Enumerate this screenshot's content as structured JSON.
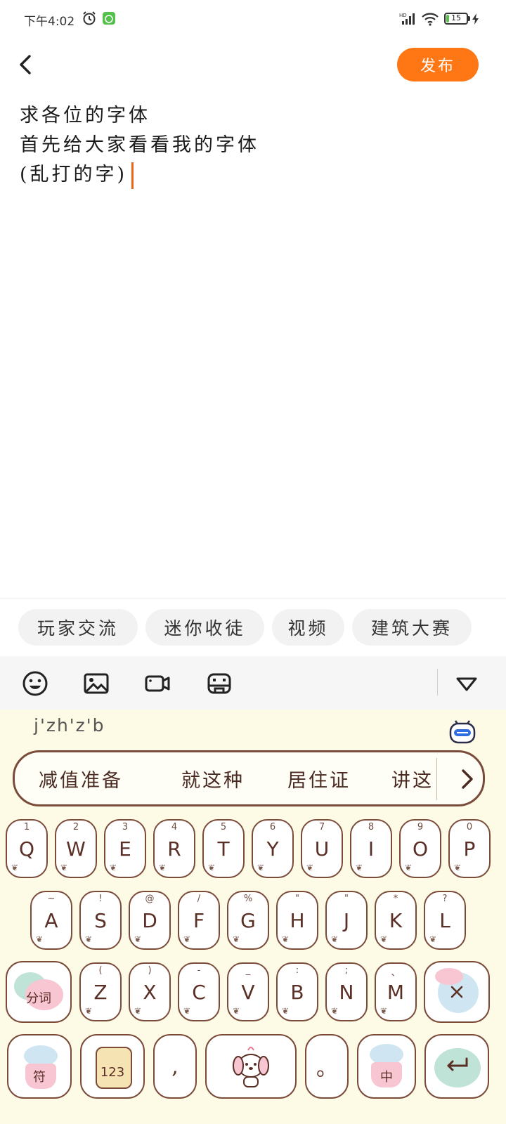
{
  "status_bar": {
    "time": "下午4:02",
    "battery_level": "15",
    "battery_fraction": 0.15
  },
  "header": {
    "publish_label": "发布"
  },
  "editor": {
    "lines": [
      "求各位的字体",
      "首先给大家看看我的字体",
      "(乱打的字)"
    ]
  },
  "topics": [
    "玩家交流",
    "迷你收徒",
    "视频",
    "建筑大赛"
  ],
  "toolbar": {
    "icons": [
      "emoji-icon",
      "image-icon",
      "video-icon",
      "game-controller-icon"
    ]
  },
  "keyboard": {
    "pinyin": "j'zh'z'b",
    "candidates": [
      "减值准备",
      "就这种",
      "居住证",
      "讲这"
    ],
    "row1": [
      {
        "label": "Q",
        "sub": "1"
      },
      {
        "label": "W",
        "sub": "2"
      },
      {
        "label": "E",
        "sub": "3"
      },
      {
        "label": "R",
        "sub": "4"
      },
      {
        "label": "T",
        "sub": "5"
      },
      {
        "label": "Y",
        "sub": "6"
      },
      {
        "label": "U",
        "sub": "7"
      },
      {
        "label": "I",
        "sub": "8"
      },
      {
        "label": "O",
        "sub": "9"
      },
      {
        "label": "P",
        "sub": "0"
      }
    ],
    "row2": [
      {
        "label": "A",
        "sub": "~"
      },
      {
        "label": "S",
        "sub": "!"
      },
      {
        "label": "D",
        "sub": "@"
      },
      {
        "label": "F",
        "sub": "/"
      },
      {
        "label": "G",
        "sub": "%"
      },
      {
        "label": "H",
        "sub": "\""
      },
      {
        "label": "J",
        "sub": "\""
      },
      {
        "label": "K",
        "sub": "*"
      },
      {
        "label": "L",
        "sub": "?"
      }
    ],
    "row3": [
      {
        "label": "Z",
        "sub": "("
      },
      {
        "label": "X",
        "sub": ")"
      },
      {
        "label": "C",
        "sub": "-"
      },
      {
        "label": "V",
        "sub": "_"
      },
      {
        "label": "B",
        "sub": ":"
      },
      {
        "label": "N",
        "sub": ";"
      },
      {
        "label": "M",
        "sub": "、"
      }
    ],
    "fenci_label": "分词",
    "symbol_label": "符",
    "num_label": "123",
    "comma_label": ",",
    "period_label": "。",
    "lang_label": "中",
    "accent_colors": {
      "frame": "#7b4b3a",
      "pink": "#f7c6d2",
      "blue": "#cfe6f2",
      "green": "#bfe3d6",
      "publish": "#ff7614"
    }
  }
}
